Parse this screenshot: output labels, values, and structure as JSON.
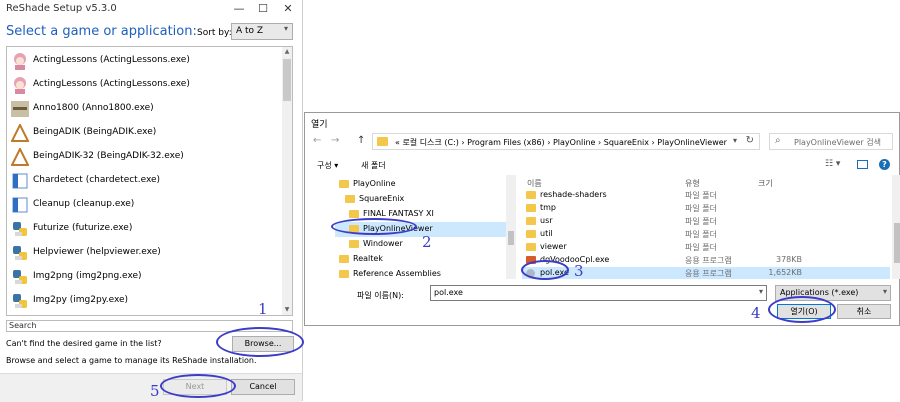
{
  "reshade": {
    "title": "ReShade Setup v5.3.0",
    "window_controls": [
      "—",
      "☐",
      "✕"
    ],
    "heading": "Select a game or application:",
    "sort_label": "Sort by:",
    "sort_value": "A to Z",
    "games": [
      {
        "label": "ActingLessons (ActingLessons.exe)",
        "icon": "anime-girl-icon"
      },
      {
        "label": "ActingLessons (ActingLessons.exe)",
        "icon": "anime-girl-icon"
      },
      {
        "label": "Anno1800 (Anno1800.exe)",
        "icon": "anno-icon"
      },
      {
        "label": "BeingADIK (BeingADIK.exe)",
        "icon": "triangle-icon"
      },
      {
        "label": "BeingADIK-32 (BeingADIK-32.exe)",
        "icon": "triangle-icon"
      },
      {
        "label": "Chardetect (chardetect.exe)",
        "icon": "window-app-icon"
      },
      {
        "label": "Cleanup (cleanup.exe)",
        "icon": "window-app-icon"
      },
      {
        "label": "Futurize (futurize.exe)",
        "icon": "python-icon"
      },
      {
        "label": "Helpviewer (helpviewer.exe)",
        "icon": "python-icon"
      },
      {
        "label": "Img2png (img2png.exe)",
        "icon": "python-icon"
      },
      {
        "label": "Img2py (img2py.exe)",
        "icon": "python-icon"
      }
    ],
    "search_placeholder": "Search",
    "cant_find_text": "Can't find the desired game in the list?",
    "browse_label": "Browse...",
    "hint_text": "Browse and select a game to manage its ReShade installation.",
    "next_label": "Next",
    "cancel_label": "Cancel"
  },
  "dialog": {
    "title": "열기",
    "nav": {
      "back": "←",
      "forward": "→",
      "up": "↑"
    },
    "address_path": "«  로컬 디스크 (C:)  ›  Program Files (x86)  ›  PlayOnline  ›  SquareEnix  ›  PlayOnlineViewer",
    "search_placeholder": "PlayOnlineViewer 검색",
    "toolbar": {
      "organize": "구성 ▾",
      "new_folder": "새 폴더"
    },
    "tree": [
      {
        "label": "PlayOnline"
      },
      {
        "label": "SquareEnix"
      },
      {
        "label": "FINAL FANTASY XI"
      },
      {
        "label": "PlayOnlineViewer"
      },
      {
        "label": "Windower"
      },
      {
        "label": "Realtek"
      },
      {
        "label": "Reference Assemblies"
      }
    ],
    "columns": {
      "name": "이름",
      "type": "유형",
      "size": "크기"
    },
    "files": [
      {
        "name": "reshade-shaders",
        "type": "파일 폴더",
        "size": "",
        "icon": "folder-icon"
      },
      {
        "name": "tmp",
        "type": "파일 폴더",
        "size": "",
        "icon": "folder-icon"
      },
      {
        "name": "usr",
        "type": "파일 폴더",
        "size": "",
        "icon": "folder-icon"
      },
      {
        "name": "util",
        "type": "파일 폴더",
        "size": "",
        "icon": "folder-icon"
      },
      {
        "name": "viewer",
        "type": "파일 폴더",
        "size": "",
        "icon": "folder-icon"
      },
      {
        "name": "dgVoodooCpl.exe",
        "type": "응용 프로그램",
        "size": "378KB",
        "icon": "app-icon"
      },
      {
        "name": "pol.exe",
        "type": "응용 프로그램",
        "size": "1,652KB",
        "icon": "pol-exe-icon"
      }
    ],
    "filename_label": "파일 이름(N):",
    "filename_value": "pol.exe",
    "filetype_value": "Applications (*.exe)",
    "open_label": "열기(O)",
    "cancel_label": "취소"
  },
  "annotations": [
    "1",
    "2",
    "3",
    "4",
    "5"
  ],
  "colors": {
    "annotation": "#3c3cc8",
    "heading": "#1f5fbf",
    "selection": "#cce8ff",
    "folder": "#f3c74b"
  }
}
